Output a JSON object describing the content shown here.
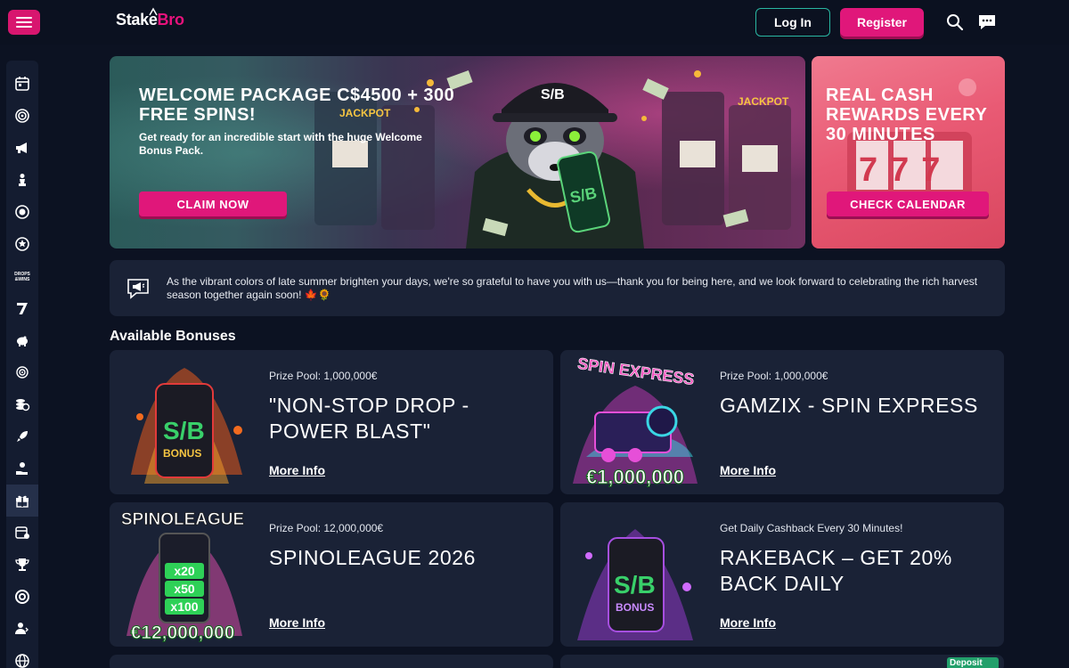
{
  "header": {
    "logo_stake": "Stake",
    "logo_bro": "Bro",
    "login_label": "Log In",
    "register_label": "Register"
  },
  "sidebar": {
    "items": [
      "calendar-icon",
      "target-icon",
      "megaphone-icon",
      "chess-pawn-icon",
      "poker-chip-icon",
      "roulette-icon",
      "drops-wins-icon",
      "seven-icon",
      "piggy-bank-icon",
      "wheel-icon",
      "coins-icon",
      "rocket-icon",
      "hand-coin-icon",
      "gift-icon",
      "calendar-star-icon",
      "trophy-icon",
      "lifebuoy-icon",
      "user-group-icon",
      "globe-icon"
    ],
    "drops_label": "DROPS & WINS"
  },
  "banners": {
    "main": {
      "title_line1": "WELCOME PACKAGE C$4500 + 300",
      "title_line2": "FREE SPINS!",
      "sub_line1": "Get ready for an incredible start with the huge Welcome",
      "sub_line2": "Bonus Pack.",
      "cta": "CLAIM NOW",
      "art_labels": {
        "jackpot": "JACKPOT",
        "can": "S/B"
      }
    },
    "side": {
      "title_line1": "REAL CASH",
      "title_line2": "REWARDS EVERY",
      "title_line3": "30 MINUTES",
      "cta": "CHECK CALENDAR",
      "art_label": "777"
    }
  },
  "notice": {
    "text": "As the vibrant colors of late summer brighten your days, we're so grateful to have you with us—thank you for being here, and we look forward to celebrating the rich harvest season together again soon! 🍁🌻"
  },
  "bonuses": {
    "section_title": "Available Bonuses",
    "cards": [
      {
        "meta": "Prize Pool: 1,000,000€",
        "title": "\"NON-STOP DROP - POWER BLAST\"",
        "link": "More Info",
        "art_text": "BONUS",
        "art_logo": "S/B"
      },
      {
        "meta": "Prize Pool: 1,000,000€",
        "title": "GAMZIX - SPIN EXPRESS",
        "link": "More Info",
        "art_text": "SPIN EXPRESS",
        "art_amount": "€1,000,000"
      },
      {
        "meta": "Prize Pool: 12,000,000€",
        "title": "SPINOLEAGUE 2026",
        "link": "More Info",
        "art_text": "SPINOLEAGUE",
        "art_amount": "€12,000,000",
        "art_multipliers": [
          "x20",
          "x50",
          "x100"
        ]
      },
      {
        "meta": "Get Daily Cashback Every 30 Minutes!",
        "title": "RAKEBACK – GET 20% BACK DAILY",
        "link": "More Info",
        "art_text": "BONUS",
        "art_logo": "S/B"
      }
    ],
    "deposit_badge": "Deposit"
  },
  "colors": {
    "accent": "#e0177a",
    "teal": "#29b7a2",
    "background": "#0c1222",
    "card": "#1a2236"
  }
}
